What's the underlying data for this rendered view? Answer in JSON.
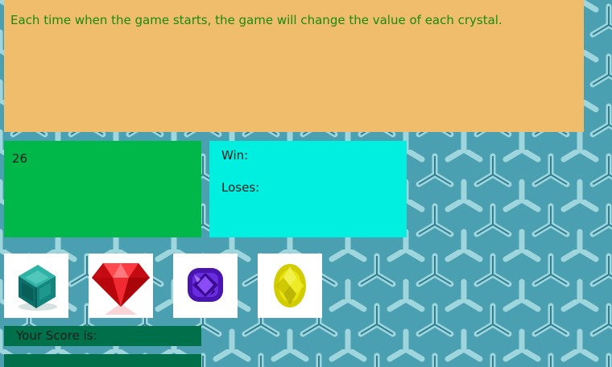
{
  "instructions": {
    "text": "Each time when the game starts, the game will change the value of each crystal."
  },
  "target": {
    "value": "26"
  },
  "stats": {
    "win_label": "Win:",
    "win_value": "",
    "loses_label": "Loses:",
    "loses_value": ""
  },
  "crystals": [
    {
      "name": "teal-cube-crystal",
      "color": "#0f8f86"
    },
    {
      "name": "red-diamond-crystal",
      "color": "#e8141c"
    },
    {
      "name": "purple-cushion-crystal",
      "color": "#5a1fc8"
    },
    {
      "name": "yellow-oval-crystal",
      "color": "#dbd800"
    }
  ],
  "score": {
    "label": "Your Score is:",
    "value": ""
  },
  "colors": {
    "instructions_bg": "#f0bd6c",
    "instructions_text": "#1a8a10",
    "target_bg": "#00b84a",
    "stats_bg": "#00efe0",
    "score_bg": "#00704a",
    "page_bg": "#4fa3b3"
  }
}
